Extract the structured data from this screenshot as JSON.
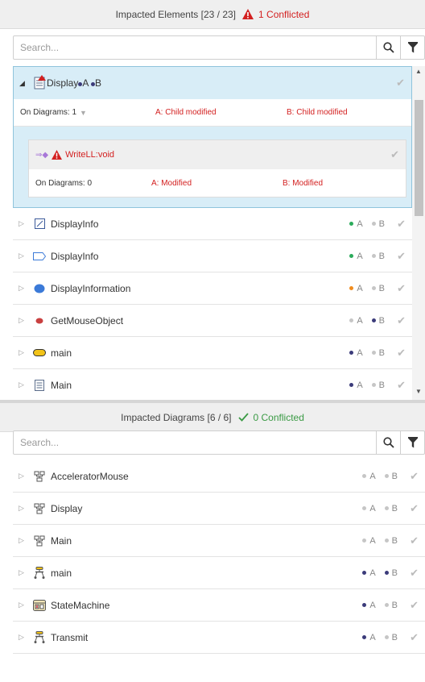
{
  "elements_panel": {
    "title": "Impacted Elements [23 / 23]",
    "conflict_text": "1 Conflicted",
    "search_placeholder": "Search...",
    "expanded": {
      "label": "Display",
      "a": "A",
      "b": "B",
      "a_color": "#3b3b7a",
      "b_color": "#3b3b7a",
      "on_diagrams": "On Diagrams: 1",
      "a_status": "A: Child modified",
      "b_status": "B: Child modified",
      "child": {
        "label": "WriteLL:void",
        "on_diagrams": "On Diagrams: 0",
        "a_status": "A: Modified",
        "b_status": "B: Modified"
      }
    },
    "rows": [
      {
        "label": "DisplayInfo",
        "icon": "note-icon",
        "a_color": "#2bab5b",
        "b_color": "#c6c6c6"
      },
      {
        "label": "DisplayInfo",
        "icon": "tag-outline-icon",
        "a_color": "#2bab5b",
        "b_color": "#c6c6c6"
      },
      {
        "label": "DisplayInformation",
        "icon": "blue-ellipse-icon",
        "a_color": "#f08c1e",
        "b_color": "#c6c6c6"
      },
      {
        "label": "GetMouseObject",
        "icon": "red-ellipse-icon",
        "a_color": "#c6c6c6",
        "b_color": "#3b3b7a"
      },
      {
        "label": "main",
        "icon": "yellow-pill-icon",
        "a_color": "#3b3b7a",
        "b_color": "#c6c6c6"
      },
      {
        "label": "Main",
        "icon": "document-icon",
        "a_color": "#3b3b7a",
        "b_color": "#c6c6c6"
      }
    ]
  },
  "diagrams_panel": {
    "title": "Impacted Diagrams [6 / 6]",
    "conflict_text": "0 Conflicted",
    "search_placeholder": "Search...",
    "rows": [
      {
        "label": "AcceleratorMouse",
        "icon": "class-diagram-icon",
        "a_color": "#c6c6c6",
        "b_color": "#c6c6c6"
      },
      {
        "label": "Display",
        "icon": "class-diagram-icon",
        "a_color": "#c6c6c6",
        "b_color": "#c6c6c6"
      },
      {
        "label": "Main",
        "icon": "class-diagram-icon",
        "a_color": "#c6c6c6",
        "b_color": "#c6c6c6"
      },
      {
        "label": "main",
        "icon": "activity-diagram-icon",
        "a_color": "#3b3b7a",
        "b_color": "#3b3b7a"
      },
      {
        "label": "StateMachine",
        "icon": "state-machine-icon",
        "a_color": "#3b3b7a",
        "b_color": "#c6c6c6"
      },
      {
        "label": "Transmit",
        "icon": "activity-diagram-icon",
        "a_color": "#3b3b7a",
        "b_color": "#c6c6c6"
      }
    ]
  },
  "colors": {
    "conflict_red": "#d32020",
    "ok_green": "#3a9a44",
    "selection_bg": "#d8edf7"
  }
}
